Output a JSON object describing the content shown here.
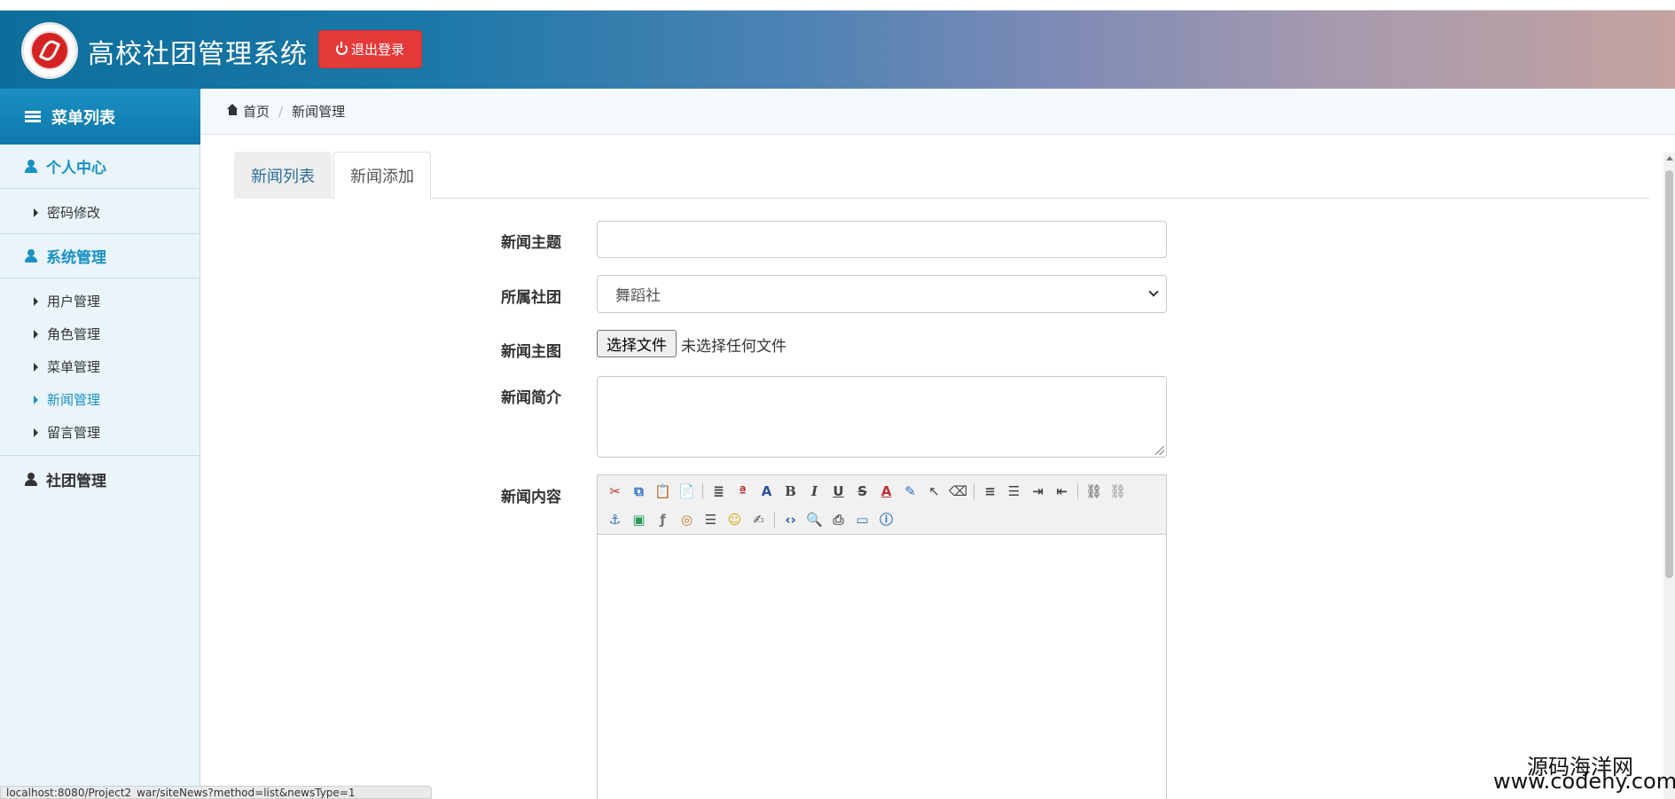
{
  "header": {
    "title": "高校社团管理系统",
    "logout_label": "退出登录"
  },
  "sidebar": {
    "title": "菜单列表",
    "groups": [
      {
        "label": "个人中心",
        "items": [
          {
            "label": "密码修改"
          }
        ]
      },
      {
        "label": "系统管理",
        "items": [
          {
            "label": "用户管理"
          },
          {
            "label": "角色管理"
          },
          {
            "label": "菜单管理"
          },
          {
            "label": "新闻管理"
          },
          {
            "label": "留言管理"
          }
        ]
      },
      {
        "label": "社团管理",
        "items": []
      }
    ],
    "current_item": "新闻管理"
  },
  "breadcrumb": {
    "home": "首页",
    "current": "新闻管理"
  },
  "tabs": [
    {
      "label": "新闻列表"
    },
    {
      "label": "新闻添加"
    }
  ],
  "form": {
    "subject_label": "新闻主题",
    "subject_value": "",
    "club_label": "所属社团",
    "club_selected": "舞蹈社",
    "image_label": "新闻主图",
    "file_button": "选择文件",
    "file_status": "未选择任何文件",
    "summary_label": "新闻简介",
    "summary_value": "",
    "content_label": "新闻内容"
  },
  "editor_toolbar": {
    "row1": [
      "cut-icon",
      "copy-icon",
      "paste-icon",
      "paste-text-icon",
      "|",
      "justify-icon",
      "spellcheck-icon",
      "font-style-icon",
      "bold-icon",
      "italic-icon",
      "underline-icon",
      "strikethrough-icon",
      "font-color-icon",
      "highlight-color-icon",
      "select-icon",
      "eraser-icon",
      "|",
      "align-left-icon",
      "bullet-list-icon",
      "indent-icon",
      "outdent-icon",
      "|",
      "link-icon",
      "unlink-icon"
    ],
    "row2": [
      "anchor-icon",
      "image-icon",
      "flash-icon",
      "media-icon",
      "horizontal-rule-icon",
      "emoticon-icon",
      "edit-icon",
      "|",
      "source-code-icon",
      "preview-icon",
      "print-icon",
      "fullscreen-icon",
      "about-icon"
    ]
  },
  "statusbar": {
    "url": "localhost:8080/Project2_war/siteNews?method=list&newsType=1"
  },
  "watermark": {
    "line1": "源码海洋网",
    "line2": "www.codehy.com"
  },
  "colors": {
    "accent": "#1a90c4",
    "logout": "#e5393a",
    "sidebar_bg": "#eaf5fa"
  }
}
